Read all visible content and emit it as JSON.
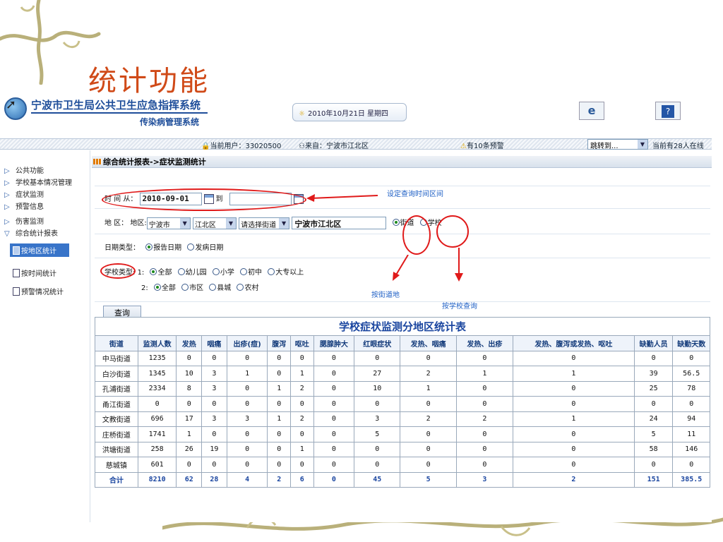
{
  "slide": {
    "title": "统计功能"
  },
  "header": {
    "system_title": "宁波市卫生局公共卫生应急指挥系统",
    "system_subtitle": "传染病管理系统",
    "date": "2010年10月21日 星期四",
    "refresh_icon": "ie-icon",
    "help_icon": "help-icon",
    "help_glyph": "?",
    "refresh_glyph": "e"
  },
  "infobar": {
    "current_user": "当前用户：33020500",
    "origin": "来自：宁波市江北区",
    "alerts": "有10条预警",
    "jump_label": "跳转到...",
    "online": "当前有28人在线"
  },
  "sidebar": {
    "items": [
      {
        "label": "公共功能"
      },
      {
        "label": "学校基本情况管理"
      },
      {
        "label": "症状监测"
      },
      {
        "label": "预警信息"
      },
      {
        "label": "伤害监测"
      },
      {
        "label": "综合统计报表"
      }
    ],
    "sub_items": [
      {
        "label": "按地区统计"
      },
      {
        "label": "按时间统计"
      },
      {
        "label": "预警情况统计"
      }
    ]
  },
  "panel": {
    "title": "综合统计报表->症状监测统计"
  },
  "form": {
    "time_label": "时 间 从：",
    "date_from": "2010-09-01",
    "to_label": "到",
    "date_to": "",
    "region_label": "地  区：",
    "region_prefix": "地区:",
    "city": "宁波市",
    "district": "江北区",
    "street_placeholder": "请选择街道",
    "region_text": "宁波市江北区",
    "mode_street": "街道",
    "mode_school": "学校",
    "date_type_label": "日期类型：",
    "date_type_report": "报告日期",
    "date_type_onset": "发病日期",
    "school_type_label": "学校类型:",
    "row1_prefix": "1:",
    "row1_options": [
      "全部",
      "幼儿园",
      "小学",
      "初中",
      "大专以上"
    ],
    "row2_prefix": "2:",
    "row2_options": [
      "全部",
      "市区",
      "县城",
      "农村"
    ],
    "query_button": "查询"
  },
  "annotations": {
    "set_time": "设定查询时间区间",
    "by_street": "按街道地",
    "by_school": "按学校查询"
  },
  "table": {
    "title": "学校症状监测分地区统计表",
    "headers": [
      "街道",
      "监测人数",
      "发热",
      "咽痛",
      "出疹(痘)",
      "腹泻",
      "呕吐",
      "腮腺肿大",
      "红眼症状",
      "发热、咽痛",
      "发热、出疹",
      "发热、腹泻或发热、呕吐",
      "缺勤人员",
      "缺勤天数"
    ],
    "rows": [
      [
        "中马街道",
        "1235",
        "0",
        "0",
        "0",
        "0",
        "0",
        "0",
        "0",
        "0",
        "0",
        "0",
        "0",
        "0"
      ],
      [
        "白沙街道",
        "1345",
        "10",
        "3",
        "1",
        "0",
        "1",
        "0",
        "27",
        "2",
        "1",
        "1",
        "39",
        "56.5"
      ],
      [
        "孔浦街道",
        "2334",
        "8",
        "3",
        "0",
        "1",
        "2",
        "0",
        "10",
        "1",
        "0",
        "0",
        "25",
        "78"
      ],
      [
        "甬江街道",
        "0",
        "0",
        "0",
        "0",
        "0",
        "0",
        "0",
        "0",
        "0",
        "0",
        "0",
        "0",
        "0"
      ],
      [
        "文教街道",
        "696",
        "17",
        "3",
        "3",
        "1",
        "2",
        "0",
        "3",
        "2",
        "2",
        "1",
        "24",
        "94"
      ],
      [
        "庄桥街道",
        "1741",
        "1",
        "0",
        "0",
        "0",
        "0",
        "0",
        "5",
        "0",
        "0",
        "0",
        "5",
        "11"
      ],
      [
        "洪塘街道",
        "258",
        "26",
        "19",
        "0",
        "0",
        "1",
        "0",
        "0",
        "0",
        "0",
        "0",
        "58",
        "146"
      ],
      [
        "慈城镇",
        "601",
        "0",
        "0",
        "0",
        "0",
        "0",
        "0",
        "0",
        "0",
        "0",
        "0",
        "0",
        "0"
      ]
    ],
    "total": [
      "合计",
      "8210",
      "62",
      "28",
      "4",
      "2",
      "6",
      "0",
      "45",
      "5",
      "3",
      "2",
      "151",
      "385.5"
    ]
  },
  "colors": {
    "accent": "#1f4e9a",
    "annotation_red": "#e01a1a",
    "title_orange": "#d04a18"
  }
}
